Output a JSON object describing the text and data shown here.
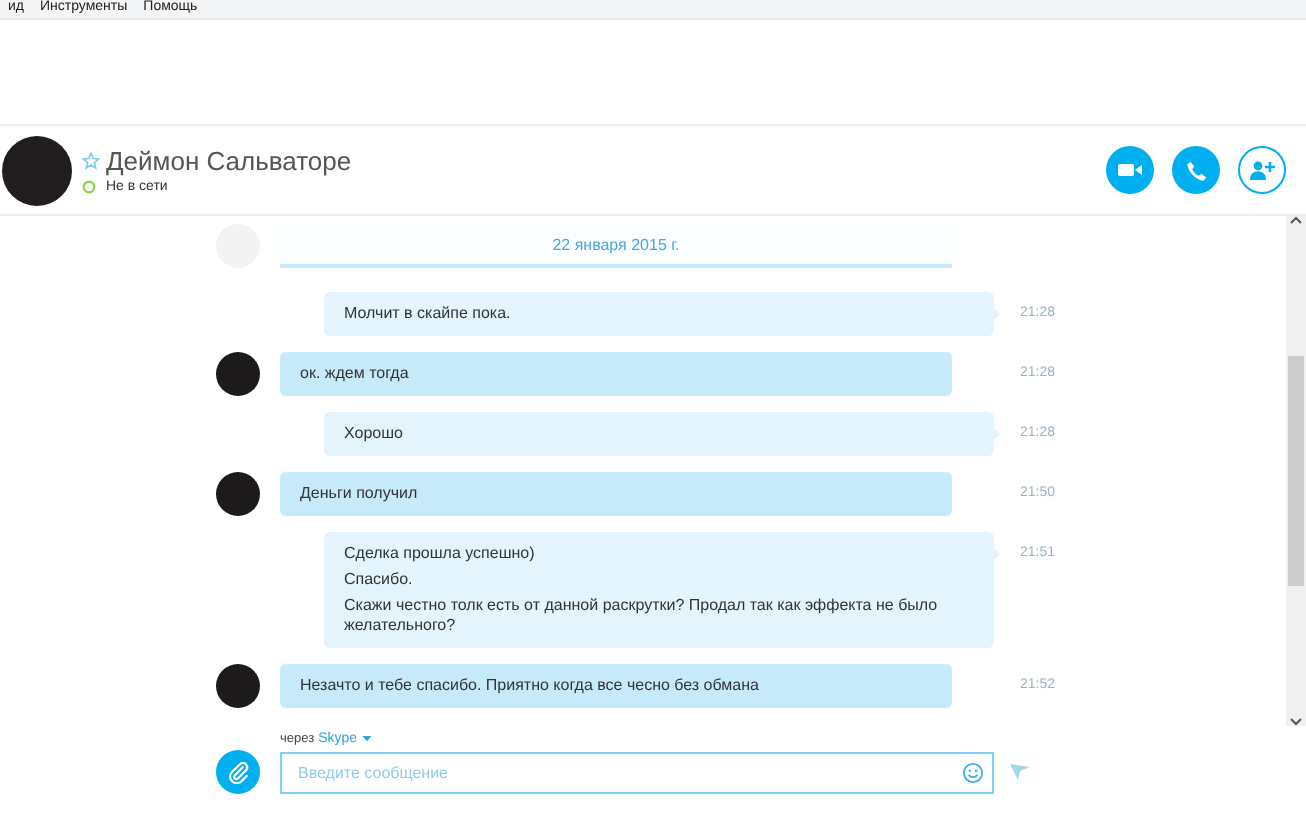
{
  "menu": [
    "ид",
    "Инструменты",
    "Помощь"
  ],
  "contact": {
    "name": "Деймон Сальваторе",
    "favorite": false,
    "status": "Не в сети"
  },
  "date_banner": "22 января 2015 г.",
  "messages": [
    {
      "kind": "outgoing",
      "lines": [
        "Молчит в скайпе пока."
      ],
      "time": "21:28"
    },
    {
      "kind": "incoming",
      "lines": [
        "ок. ждем тогда"
      ],
      "time": "21:28"
    },
    {
      "kind": "outgoing",
      "lines": [
        "Хорошо"
      ],
      "time": "21:28"
    },
    {
      "kind": "incoming",
      "lines": [
        "Деньги получил"
      ],
      "time": "21:50"
    },
    {
      "kind": "outgoing",
      "lines": [
        "Сделка прошла успешно)",
        "Спасибо.",
        "Скажи честно толк есть от данной раскрутки? Продал так как эффекта не было желательного?"
      ],
      "time": "21:51"
    },
    {
      "kind": "incoming",
      "lines": [
        "Незачто и тебе спасибо. Приятно когда все чесно без обмана"
      ],
      "time": "21:52"
    }
  ],
  "compose": {
    "via_label": "через",
    "via_service": "Skype",
    "placeholder": "Введите сообщение"
  }
}
